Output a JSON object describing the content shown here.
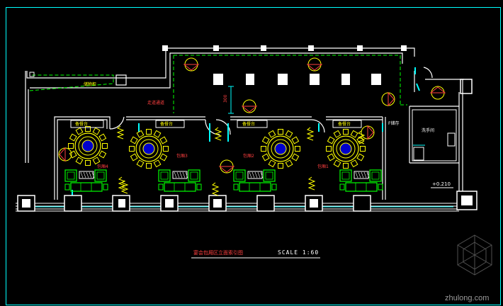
{
  "drawing": {
    "title_cn": "宴会包厢区立面索引图",
    "scale_label": "SCALE 1:60",
    "elevation_mark": "+0.210",
    "watermark": "zhulong.com",
    "colors": {
      "background": "#000000",
      "wall": "#ffffff",
      "glass": "#00ffff",
      "tables": "#ffff00",
      "sofa": "#00ff00",
      "labels": "#ff4040",
      "dashed": "#00ff00",
      "circle_fill": "#0000cc"
    }
  },
  "rooms": {
    "corridor_label": "走道通道",
    "room1": "包厢1",
    "room2": "包厢2",
    "room3": "包厢3",
    "room4": "包厢4",
    "service1": "备餐台",
    "service2": "备餐台",
    "service3": "备餐台",
    "service4": "备餐台",
    "toilet": "洗手间",
    "storage": "F储存",
    "dim_text": "300",
    "small_text": "储物柜"
  }
}
